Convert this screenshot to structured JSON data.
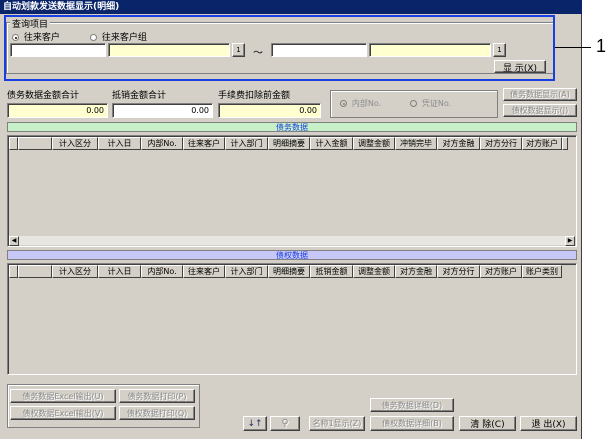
{
  "window": {
    "title": "自动划款发送数据显示(明细)"
  },
  "query": {
    "group_label": "查询项目",
    "radio_customer": "往来客户",
    "radio_customer_group": "往来客户组",
    "lookup_btn": "1",
    "tilde": "～",
    "show_btn": "显 示(X)"
  },
  "summary": {
    "debt_total_label": "债务数据金额合计",
    "debt_total_value": "0.00",
    "offset_total_label": "抵销金额合计",
    "offset_total_value": "0.00",
    "fee_label": "手续费扣除前金额",
    "fee_value": "0.00",
    "radio_internal": "内部No.",
    "radio_voucher": "凭证No.",
    "debt_show_btn": "债务数据显示(A)",
    "credit_show_btn": "债权数据显示(J)"
  },
  "debt_table": {
    "title": "债务数据",
    "columns": [
      "计入区分",
      "计入日",
      "内部No.",
      "往来客户",
      "计入部门",
      "明细摘要",
      "计入金额",
      "调整金额",
      "冲销完毕",
      "对方金融",
      "对方分行",
      "对方账户"
    ]
  },
  "credit_table": {
    "title": "债权数据",
    "columns": [
      "计入区分",
      "计入日",
      "内部No.",
      "往来客户",
      "计入部门",
      "明细摘要",
      "抵销金额",
      "调整金额",
      "对方金融",
      "对方分行",
      "对方账户",
      "账户类别"
    ]
  },
  "footer": {
    "debt_excel_btn": "债务数据Excel输出(U)",
    "debt_print_btn": "债务数据打印(P)",
    "credit_excel_btn": "债权数据Excel输出(V)",
    "credit_print_btn": "债权数据打印(Q)",
    "debt_detail_btn": "债务数据详细(D)",
    "name_show_btn": "名称1显示(Z)",
    "credit_detail_btn": "债权数据详细(B)",
    "clear_btn": "清 除(C)",
    "exit_btn": "退 出(X)"
  },
  "callout": {
    "number": "1"
  },
  "colors": {
    "title_bar": "#0a246a",
    "highlight_blue": "#1a3fe0",
    "debt_bar": "#c8f0c8",
    "credit_bar": "#c8c8f8",
    "yellow_input": "#ffffd0"
  }
}
